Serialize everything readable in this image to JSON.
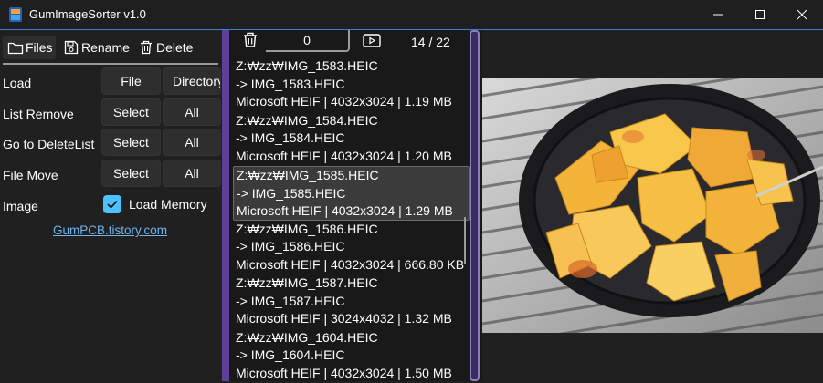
{
  "window": {
    "title": "GumImageSorter v1.0",
    "icon": "app-icon"
  },
  "toolbar": {
    "files": "Files",
    "rename": "Rename",
    "delete": "Delete"
  },
  "rows": {
    "load": {
      "label": "Load",
      "btn1": "File",
      "btn2": "Directory"
    },
    "list_remove": {
      "label": "List Remove",
      "btn1": "Select",
      "btn2": "All"
    },
    "go_delete": {
      "label": "Go to DeleteList",
      "btn1": "Select",
      "btn2": "All"
    },
    "file_move": {
      "label": "File Move",
      "btn1": "Select",
      "btn2": "All"
    },
    "image": {
      "label": "Image",
      "checkbox_label": "Load Memory",
      "checked": true
    }
  },
  "link": "GumPCB.tistory.com",
  "list_header": {
    "delete_count": "0",
    "position": "14 / 22"
  },
  "files": [
    {
      "path": "Z:₩zz₩IMG_1583.HEIC",
      "rename": "-> IMG_1583.HEIC",
      "info": "Microsoft HEIF | 4032x3024 | 1.19 MB",
      "selected": false
    },
    {
      "path": "Z:₩zz₩IMG_1584.HEIC",
      "rename": "-> IMG_1584.HEIC",
      "info": "Microsoft HEIF | 4032x3024 | 1.20 MB",
      "selected": false
    },
    {
      "path": "Z:₩zz₩IMG_1585.HEIC",
      "rename": "-> IMG_1585.HEIC",
      "info": "Microsoft HEIF | 4032x3024 | 1.29 MB",
      "selected": true
    },
    {
      "path": "Z:₩zz₩IMG_1586.HEIC",
      "rename": "-> IMG_1586.HEIC",
      "info": "Microsoft HEIF | 4032x3024 | 666.80 KB",
      "selected": false
    },
    {
      "path": "Z:₩zz₩IMG_1587.HEIC",
      "rename": "-> IMG_1587.HEIC",
      "info": "Microsoft HEIF | 3024x4032 | 1.32 MB",
      "selected": false
    },
    {
      "path": "Z:₩zz₩IMG_1604.HEIC",
      "rename": "-> IMG_1604.HEIC",
      "info": "Microsoft HEIF | 4032x3024 | 1.50 MB",
      "selected": false
    }
  ],
  "colors": {
    "accent": "#4cc2ff",
    "scrollbar": "#5d3f9c",
    "link": "#6fb4ea"
  }
}
